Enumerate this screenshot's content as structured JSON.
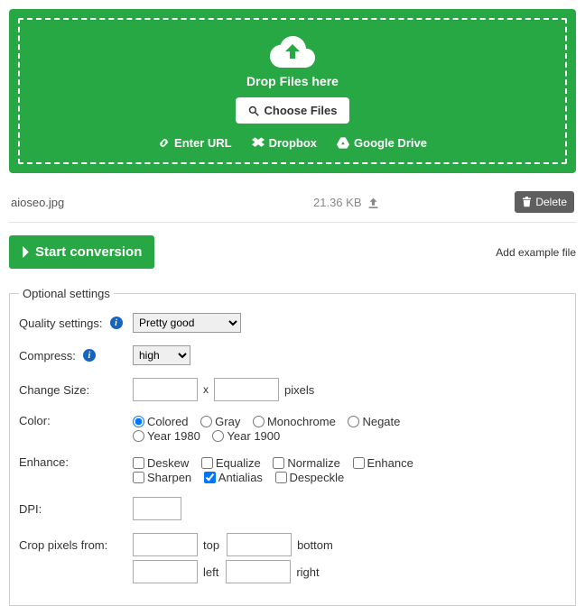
{
  "dropzone": {
    "drop_text": "Drop Files here",
    "choose_label": "Choose Files",
    "enter_url": "Enter URL",
    "dropbox": "Dropbox",
    "gdrive": "Google Drive"
  },
  "file": {
    "name": "aioseo.jpg",
    "size": "21.36 KB",
    "delete_label": "Delete"
  },
  "actions": {
    "start_label": "Start conversion",
    "example_label": "Add example file"
  },
  "optional": {
    "legend": "Optional settings",
    "quality_label": "Quality settings:",
    "quality_value": "Pretty good",
    "compress_label": "Compress:",
    "compress_value": "high",
    "size_label": "Change Size:",
    "size_x": "x",
    "size_unit": "pixels",
    "color_label": "Color:",
    "color_options": {
      "colored": "Colored",
      "gray": "Gray",
      "monochrome": "Monochrome",
      "negate": "Negate",
      "year1980": "Year 1980",
      "year1900": "Year 1900"
    },
    "enhance_label": "Enhance:",
    "enhance_options": {
      "deskew": "Deskew",
      "equalize": "Equalize",
      "normalize": "Normalize",
      "enhance": "Enhance",
      "sharpen": "Sharpen",
      "antialias": "Antialias",
      "despeckle": "Despeckle"
    },
    "dpi_label": "DPI:",
    "crop_label": "Crop pixels from:",
    "crop_units": {
      "top": "top",
      "bottom": "bottom",
      "left": "left",
      "right": "right"
    }
  }
}
